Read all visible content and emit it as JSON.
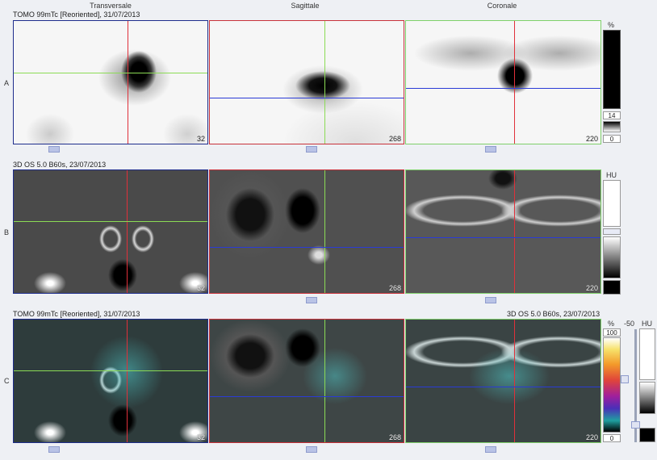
{
  "columns": [
    "Transversale",
    "Sagittale",
    "Coronale"
  ],
  "rows": [
    {
      "letter": "A",
      "title": "TOMO 99mTc [Reoriented], 31/07/2013"
    },
    {
      "letter": "B",
      "title": "3D  OS  5.0  B60s, 23/07/2013"
    },
    {
      "letter": "C",
      "title": "TOMO 99mTc [Reoriented], 31/07/2013",
      "title_right": "3D  OS  5.0  B60s, 23/07/2013"
    }
  ],
  "slices": {
    "transversale": "32",
    "sagittale": "268",
    "coronale": "220"
  },
  "scales": {
    "a": {
      "unit": "%",
      "value": "14",
      "min": "0"
    },
    "b": {
      "unit": "HU"
    },
    "c": {
      "unit": "%",
      "max": "100",
      "min": "0",
      "extra_unit": "-50",
      "hu": "HU"
    }
  },
  "colors": {
    "transversale_border": "#1e2d8c",
    "sagittale_border": "#c8323a",
    "coronale_border": "#7fd06a",
    "crosshair_red": "#e0303a",
    "crosshair_green": "#8bdb55",
    "crosshair_blue": "#2a3bd6"
  },
  "icons": [
    "colorbar-nuclear",
    "colorbar-grayscale",
    "colorbar-fusion",
    "window-slider"
  ]
}
